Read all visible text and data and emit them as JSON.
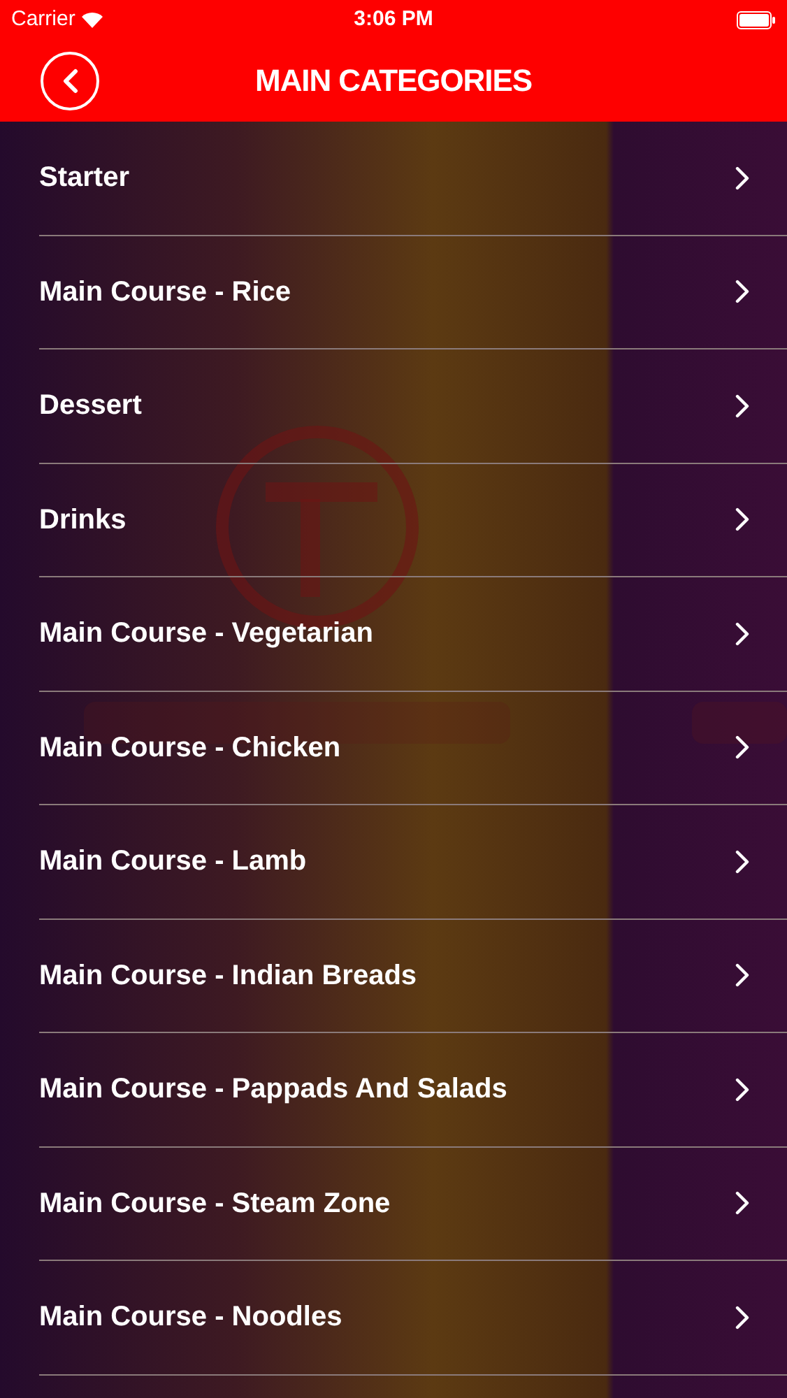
{
  "status_bar": {
    "carrier": "Carrier",
    "time": "3:06 PM"
  },
  "nav_bar": {
    "title": "MAIN CATEGORIES"
  },
  "categories": [
    {
      "label": "Starter"
    },
    {
      "label": "Main Course - Rice"
    },
    {
      "label": "Dessert"
    },
    {
      "label": "Drinks"
    },
    {
      "label": "Main Course - Vegetarian"
    },
    {
      "label": "Main Course - Chicken"
    },
    {
      "label": "Main Course - Lamb"
    },
    {
      "label": "Main Course - Indian Breads"
    },
    {
      "label": "Main Course - Pappads And Salads"
    },
    {
      "label": "Main Course - Steam Zone"
    },
    {
      "label": "Main Course - Noodles"
    }
  ]
}
